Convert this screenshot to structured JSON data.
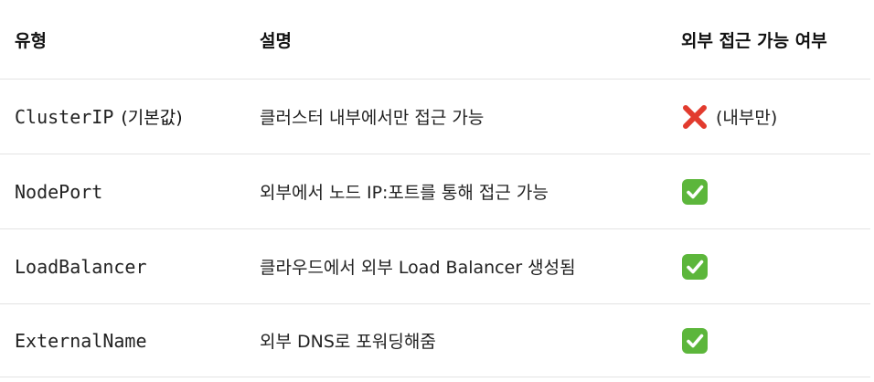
{
  "table": {
    "headers": {
      "type": "유형",
      "description": "설명",
      "external_access": "외부 접근 가능 여부"
    },
    "rows": [
      {
        "type": "ClusterIP",
        "type_note": "(기본값)",
        "description": "클러스터 내부에서만 접근 가능",
        "access_icon": "cross-mark-icon",
        "access_note": "(내부만)"
      },
      {
        "type": "NodePort",
        "description": "외부에서 노드 IP:포트를 통해 접근 가능",
        "access_icon": "check-mark-icon"
      },
      {
        "type": "LoadBalancer",
        "description": "클라우드에서 외부 Load Balancer 생성됨",
        "access_icon": "check-mark-icon"
      },
      {
        "type": "ExternalName",
        "description": "외부 DNS로 포워딩해줌",
        "access_icon": "check-mark-icon"
      }
    ]
  },
  "colors": {
    "check_green": "#5cb63b",
    "cross_red": "#e23b2e",
    "divider": "#e3e3e3"
  }
}
